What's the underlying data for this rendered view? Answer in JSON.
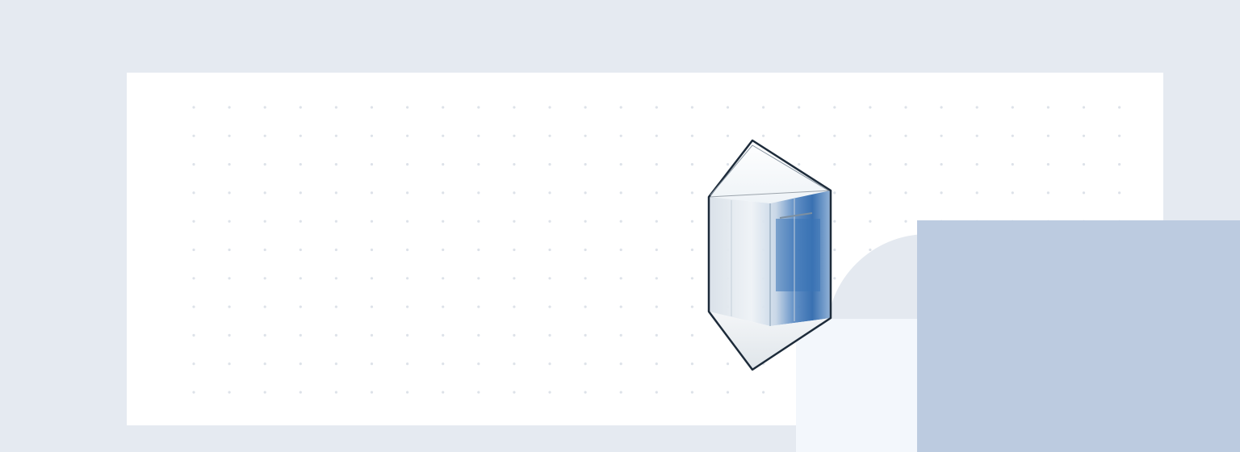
{
  "colors": {
    "page_background": "#e5eaf1",
    "panel_background": "#ffffff",
    "dot_color": "#dde2e9",
    "decor_circle": "#e4e9f0",
    "decor_pale_rect": "#f3f7fc",
    "decor_blue_rect": "#bccbe0",
    "glass_frame": "#1d2b3a",
    "glass_blue": "#3f77b8"
  },
  "illustration": {
    "icon": "elevator-cabin-icon"
  }
}
